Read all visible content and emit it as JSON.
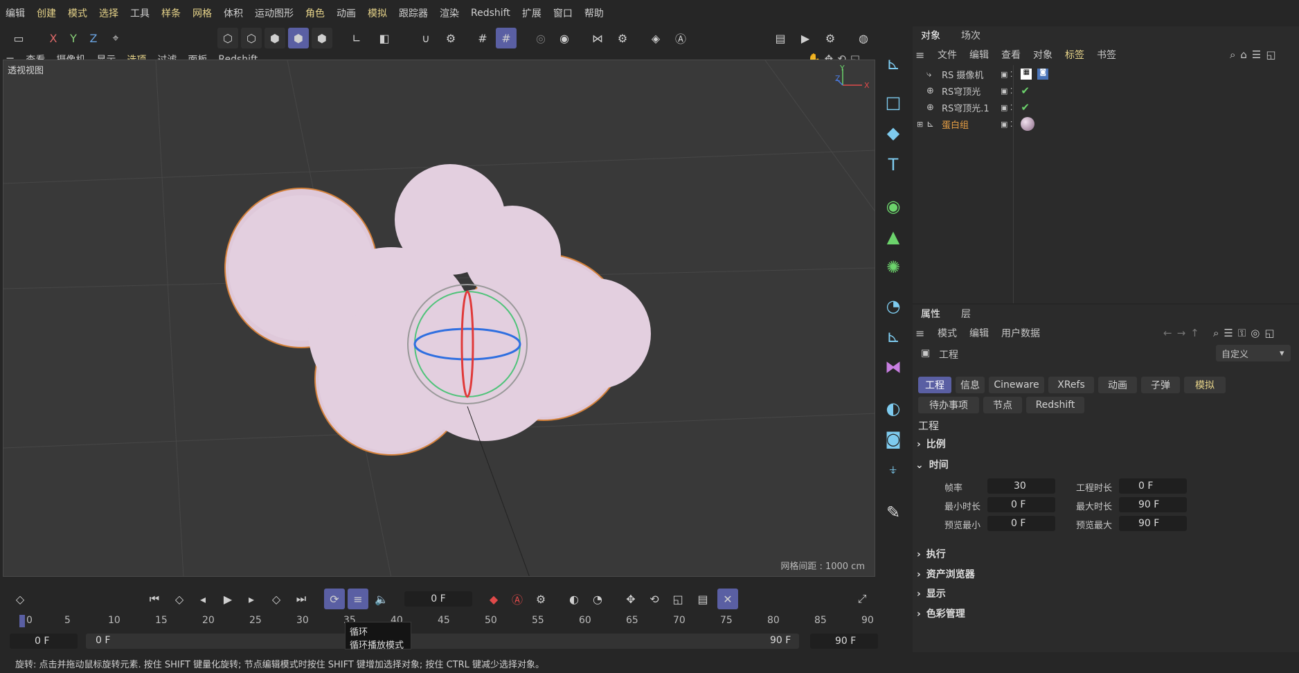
{
  "menu": [
    "编辑",
    "创建",
    "模式",
    "选择",
    "工具",
    "样条",
    "网格",
    "体积",
    "运动图形",
    "角色",
    "动画",
    "模拟",
    "跟踪器",
    "渲染",
    "Redshift",
    "扩展",
    "窗口",
    "帮助"
  ],
  "toolbar": {
    "x": "X",
    "y": "Y",
    "z": "Z"
  },
  "viewport_menu": [
    "查看",
    "摄像机",
    "显示",
    "选项",
    "过滤",
    "面板",
    "Redshift"
  ],
  "viewport": {
    "title": "透视视图",
    "grid_info": "网格间距 : 1000 cm",
    "axis_x": "X",
    "axis_y": "Y",
    "axis_z": "Z"
  },
  "object_panel": {
    "tabs": [
      "对象",
      "场次"
    ],
    "menu": [
      "文件",
      "编辑",
      "查看",
      "对象",
      "标签",
      "书签"
    ],
    "objects": [
      {
        "name": "RS 摄像机",
        "icon": "camera-object-icon",
        "color": "#d6d6d6"
      },
      {
        "name": "RS穹顶光",
        "icon": "dome-light-icon",
        "color": "#d6d6d6"
      },
      {
        "name": "RS穹顶光.1",
        "icon": "dome-light-icon",
        "color": "#d6d6d6"
      },
      {
        "name": "蛋白组",
        "icon": "null-group-icon",
        "color": "#e8a044"
      }
    ]
  },
  "attr_panel": {
    "tabs": [
      "属性",
      "层"
    ],
    "menu": [
      "模式",
      "编辑",
      "用户数据"
    ],
    "object_label": "工程",
    "preset": "自定义",
    "chips_row1": [
      "工程",
      "信息",
      "Cineware",
      "XRefs",
      "动画",
      "子弹",
      "模拟"
    ],
    "chips_row2": [
      "待办事项",
      "节点",
      "Redshift"
    ],
    "section_title": "工程",
    "sections": [
      "比例",
      "时间",
      "执行",
      "资产浏览器",
      "显示",
      "色彩管理"
    ],
    "time_fields": {
      "fps_label": "帧率",
      "fps": "30",
      "doc_len_label": "工程时长",
      "doc_len": "0 F",
      "min_label": "最小时长",
      "min": "0 F",
      "max_label": "最大时长",
      "max": "90 F",
      "pmin_label": "预览最小",
      "pmin": "0 F",
      "pmax_label": "预览最大",
      "pmax": "90 F"
    }
  },
  "timeline": {
    "current_frame": "0 F",
    "ticks": [
      "0",
      "5",
      "10",
      "15",
      "20",
      "25",
      "30",
      "35",
      "40",
      "45",
      "50",
      "55",
      "60",
      "65",
      "70",
      "75",
      "80",
      "85",
      "90"
    ],
    "range_start": "0 F",
    "range_inner_start": "0 F",
    "range_inner_end": "90 F",
    "range_end": "90 F",
    "tooltip_title": "循环",
    "tooltip_text": "循环播放模式"
  },
  "status": "旋转: 点击并拖动鼠标旋转元素. 按住 SHIFT 键量化旋转; 节点编辑模式时按住 SHIFT 键增加选择对象; 按住 CTRL 键减少选择对象。"
}
